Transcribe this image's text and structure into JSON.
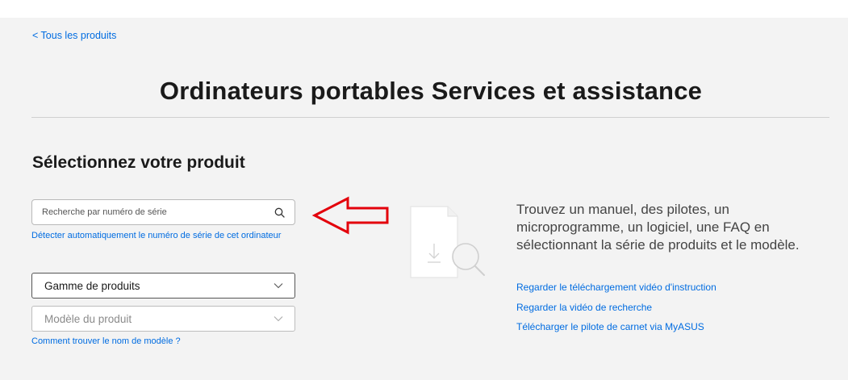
{
  "nav": {
    "back_label": "< Tous les produits"
  },
  "page": {
    "title": "Ordinateurs portables Services et assistance"
  },
  "selector": {
    "heading": "Sélectionnez votre produit",
    "search": {
      "placeholder": "Recherche par numéro de série",
      "value": "",
      "icon": "search-icon"
    },
    "detect_link": "Détecter automatiquement le numéro de série de cet ordinateur",
    "product_range": {
      "selected": "Gamme de produits"
    },
    "product_model": {
      "selected": "Modèle du produit"
    },
    "find_model_link": "Comment trouver le nom de modèle ?"
  },
  "info": {
    "description": "Trouvez un manuel, des pilotes, un microprogramme, un logiciel, une FAQ en sélectionnant la série de produits et le modèle.",
    "links": [
      "Regarder le téléchargement vidéo d'instruction",
      "Regarder la vidéo de recherche",
      "Télécharger le pilote de carnet via MyASUS"
    ]
  },
  "colors": {
    "link": "#006ce1",
    "annotation_arrow": "#e3000b",
    "panel_bg": "#f3f3f3"
  }
}
